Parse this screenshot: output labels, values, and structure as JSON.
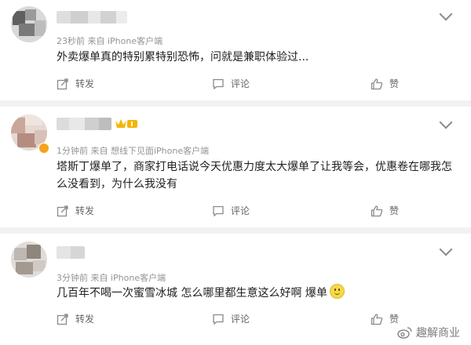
{
  "comments": [
    {
      "meta": "23秒前  来自 iPhone客户端",
      "text": "外卖爆单真的特别累特别恐怖，问就是兼职体验过...",
      "actions": {
        "repost": "转发",
        "comment": "评论",
        "like": "赞"
      }
    },
    {
      "meta": "1分钟前  来自 想线下见面iPhone客户端",
      "text": "塔斯丁爆单了，商家打电话说今天优惠力度太大爆单了让我等会，优惠卷在哪我怎么没看到，为什么我没有",
      "actions": {
        "repost": "转发",
        "comment": "评论",
        "like": "赞"
      }
    },
    {
      "meta": "3分钟前  来自 iPhone客户端",
      "text": "几百年不喝一次蜜雪冰城 怎么哪里都生意这么好啊 爆单",
      "actions": {
        "repost": "转发",
        "comment": "评论",
        "like": "赞"
      }
    }
  ],
  "watermark": {
    "text": "趣解商业"
  },
  "colors": {
    "separator": "#f2f2f2",
    "meta": "#939393",
    "vip_badge": "#f5b400"
  },
  "icons": [
    "chevron-down-icon",
    "repost-icon",
    "comment-icon",
    "like-icon",
    "vip-badge-icon",
    "smile-emoji-icon",
    "weibo-logo-icon"
  ]
}
